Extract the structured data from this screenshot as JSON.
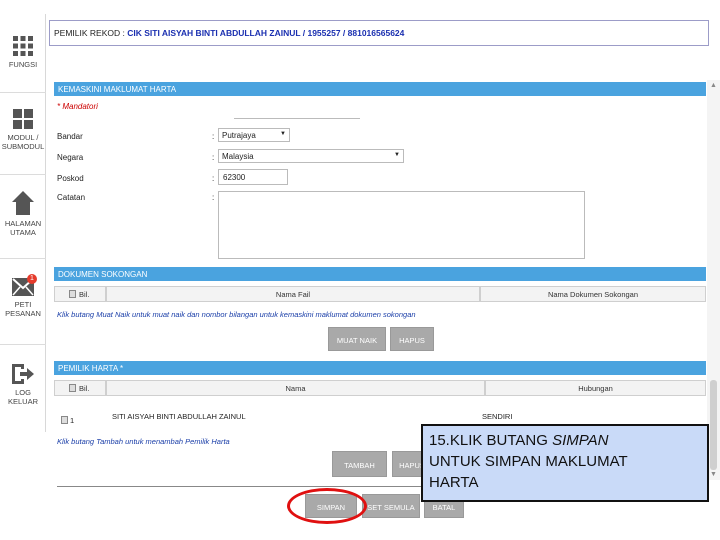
{
  "sidebar": {
    "items": [
      {
        "label_1": "FUNGSI",
        "label_2": "",
        "icon": "grid-icon"
      },
      {
        "label_1": "MODUL /",
        "label_2": "SUBMODUL",
        "icon": "modules-icon"
      },
      {
        "label_1": "HALAMAN",
        "label_2": "UTAMA",
        "icon": "home-icon"
      },
      {
        "label_1": "PETI",
        "label_2": "PESANAN",
        "icon": "mail-icon",
        "badge": "1"
      },
      {
        "label_1": "LOG",
        "label_2": "KELUAR",
        "icon": "logout-icon"
      }
    ]
  },
  "header": {
    "label": "PEMILIK REKOD :",
    "value": "CIK SITI AISYAH BINTI ABDULLAH ZAINUL / 1955257 / 881016565624"
  },
  "form_section": {
    "title": "KEMASKINI MAKLUMAT HARTA",
    "mandatory": "* Mandatori",
    "fields": {
      "bandar_label": "Bandar",
      "bandar_value": "Putrajaya",
      "negara_label": "Negara",
      "negara_value": "Malaysia",
      "poskod_label": "Poskod",
      "poskod_value": "62300",
      "catatan_label": "Catatan",
      "catatan_value": ""
    },
    "colon": ":"
  },
  "documents": {
    "title": "DOKUMEN SOKONGAN",
    "headers": [
      "Bil.",
      "Nama Fail",
      "Nama Dokumen Sokongan"
    ],
    "hint": "Klik butang Muat Naik untuk muat naik dan nombor bilangan untuk kemaskini maklumat dokumen sokongan",
    "btn_upload": "MUAT NAIK",
    "btn_delete": "HAPUS"
  },
  "owners": {
    "title": "PEMILIK HARTA",
    "title_marker": "*",
    "headers": [
      "Bil.",
      "Nama",
      "Hubungan"
    ],
    "rows": [
      {
        "no": "1",
        "name": "SITI AISYAH BINTI ABDULLAH ZAINUL",
        "relation": "SENDIRI"
      }
    ],
    "hint": "Klik butang Tambah untuk menambah Pemilik Harta",
    "btn_add": "TAMBAH",
    "btn_delete": "HAPUS"
  },
  "actions": {
    "save": "SIMPAN",
    "reset": "SET SEMULA",
    "cancel": "BATAL"
  },
  "callout": {
    "line1_prefix": "15.KLIK BUTANG ",
    "line1_italic": "SIMPAN",
    "line2": "UNTUK SIMPAN MAKLUMAT",
    "line3": "HARTA"
  }
}
